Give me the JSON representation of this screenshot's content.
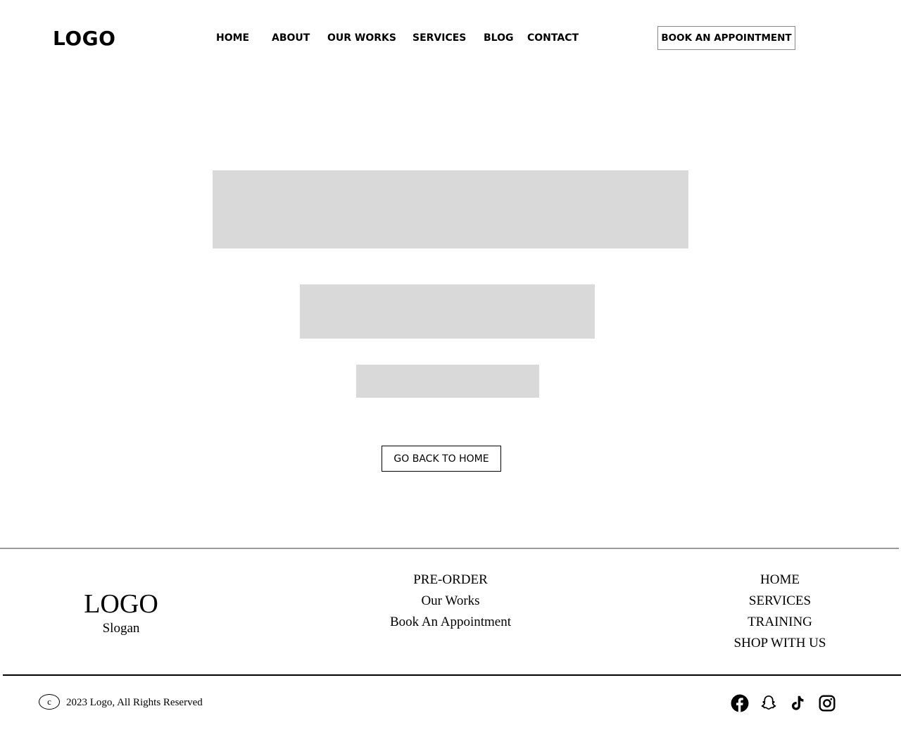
{
  "header": {
    "logo": "LOGO",
    "nav": [
      "HOME",
      "ABOUT",
      "OUR WORKS",
      "SERVICES",
      "BLOG",
      "CONTACT"
    ],
    "cta": "BOOK AN APPOINTMENT"
  },
  "main": {
    "back_button": "GO BACK TO HOME"
  },
  "footer": {
    "logo": "LOGO",
    "slogan": "Slogan",
    "links_col1": [
      "PRE-ORDER",
      "Our Works",
      "Book An Appointment"
    ],
    "links_col2": [
      "HOME",
      "SERVICES",
      "TRAINING",
      "SHOP WITH US"
    ],
    "copyright_symbol": "c",
    "copyright": "2023 Logo, All Rights Reserved",
    "social_icons": [
      "facebook-icon",
      "snapchat-icon",
      "tiktok-icon",
      "instagram-icon"
    ]
  },
  "colors": {
    "placeholder": "#d9d9d9",
    "divider": "#9a9a9a",
    "text": "#000000"
  }
}
